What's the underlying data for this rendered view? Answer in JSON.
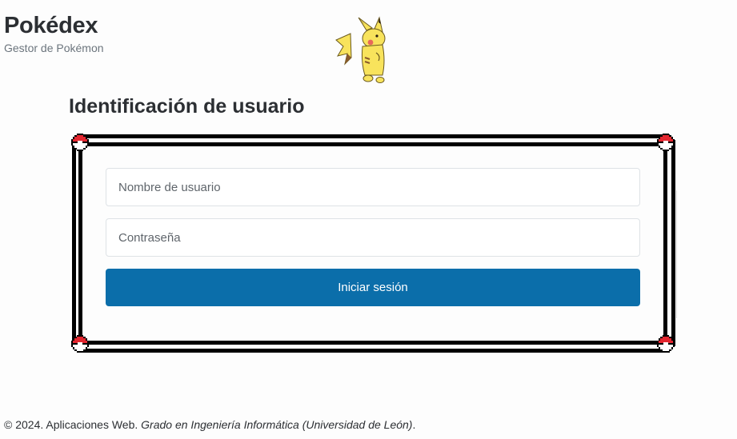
{
  "header": {
    "title": "Pokédex",
    "subtitle": "Gestor de Pokémon",
    "mascot_icon": "pikachu-icon"
  },
  "login": {
    "heading": "Identificación de usuario",
    "username_placeholder": "Nombre de usuario",
    "username_value": "",
    "password_placeholder": "Contraseña",
    "password_value": "",
    "submit_label": "Iniciar sesión",
    "frame_corner_icon": "pokeball-icon"
  },
  "footer": {
    "text": "© 2024. Aplicaciones Web. ",
    "degree": "Grado en Ingeniería Informática (Universidad de León)",
    "end": "."
  },
  "colors": {
    "primary_button": "#0b6eaa",
    "pokeball_red": "#e3262f",
    "frame_border": "#000000",
    "pikachu_yellow": "#f8e35c"
  }
}
